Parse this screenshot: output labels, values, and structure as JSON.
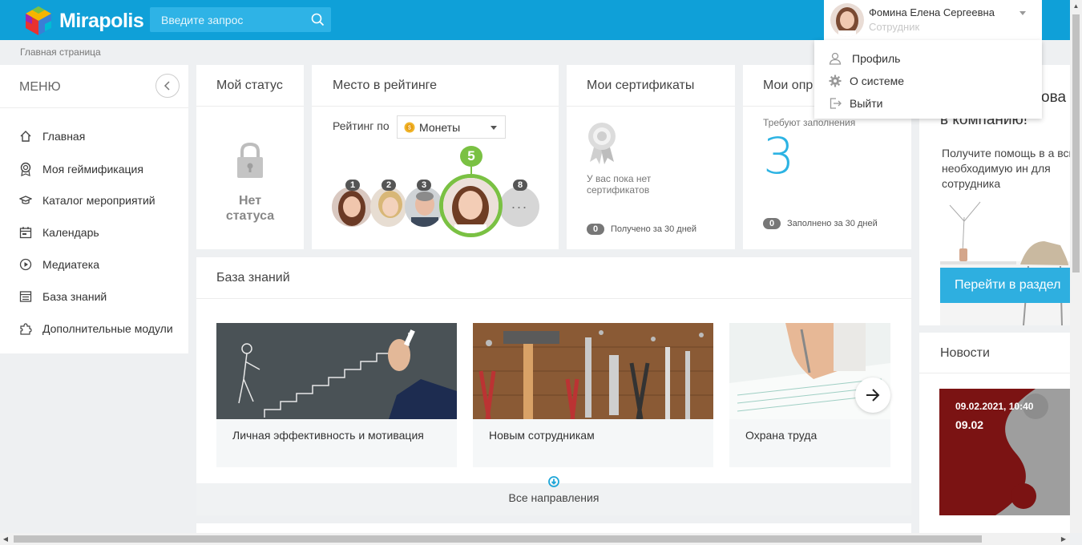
{
  "app": {
    "name": "Mirapolis"
  },
  "search": {
    "placeholder": "Введите запрос"
  },
  "user": {
    "name": "Фомина Елена Сергеевна",
    "role": "Сотрудник"
  },
  "user_menu": [
    {
      "label": "Профиль",
      "icon": "user-icon"
    },
    {
      "label": "О системе",
      "icon": "gear-icon"
    },
    {
      "label": "Выйти",
      "icon": "logout-icon"
    }
  ],
  "breadcrumb": "Главная страница",
  "sidebar": {
    "title": "МЕНЮ",
    "items": [
      {
        "label": "Главная",
        "icon": "home-icon"
      },
      {
        "label": "Моя геймификация",
        "icon": "award-icon"
      },
      {
        "label": "Каталог мероприятий",
        "icon": "graduation-cap-icon"
      },
      {
        "label": "Календарь",
        "icon": "calendar-icon"
      },
      {
        "label": "Медиатека",
        "icon": "play-icon"
      },
      {
        "label": "База знаний",
        "icon": "knowledge-icon"
      },
      {
        "label": "Дополнительные модули",
        "icon": "puzzle-icon"
      }
    ]
  },
  "status_card": {
    "title": "Мой статус",
    "text": "Нет статуса"
  },
  "rating_card": {
    "title": "Место в рейтинге",
    "rating_by": "Рейтинг по",
    "select": "Монеты",
    "my_place": "5",
    "places": [
      "1",
      "2",
      "3",
      "8"
    ]
  },
  "cert_card": {
    "title": "Мои сертификаты",
    "empty": "У вас пока нет сертификатов",
    "count": "0",
    "count_label": "Получено за 30 дней"
  },
  "survey_card": {
    "title": "Мои опр",
    "need": "Требуют заполнения",
    "value": "3",
    "count": "0",
    "count_label": "Заполнено за 30 дней"
  },
  "promo": {
    "title_partial": "в компанию!",
    "title_top": "ова",
    "text": "Получите помощь в а всю необходимую ин для сотрудника",
    "button": "Перейти в раздел"
  },
  "kb": {
    "title": "База знаний",
    "items": [
      {
        "label": "Личная эффективность и мотивация"
      },
      {
        "label": "Новым сотрудникам"
      },
      {
        "label": "Охрана труда"
      }
    ],
    "all": "Все направления"
  },
  "news": {
    "title": "Новости",
    "datetime": "09.02.2021, 10:40",
    "date": "09.02"
  },
  "colors": {
    "accent": "#0fa0d8",
    "green": "#7ac143",
    "number": "#2cb3e3"
  }
}
